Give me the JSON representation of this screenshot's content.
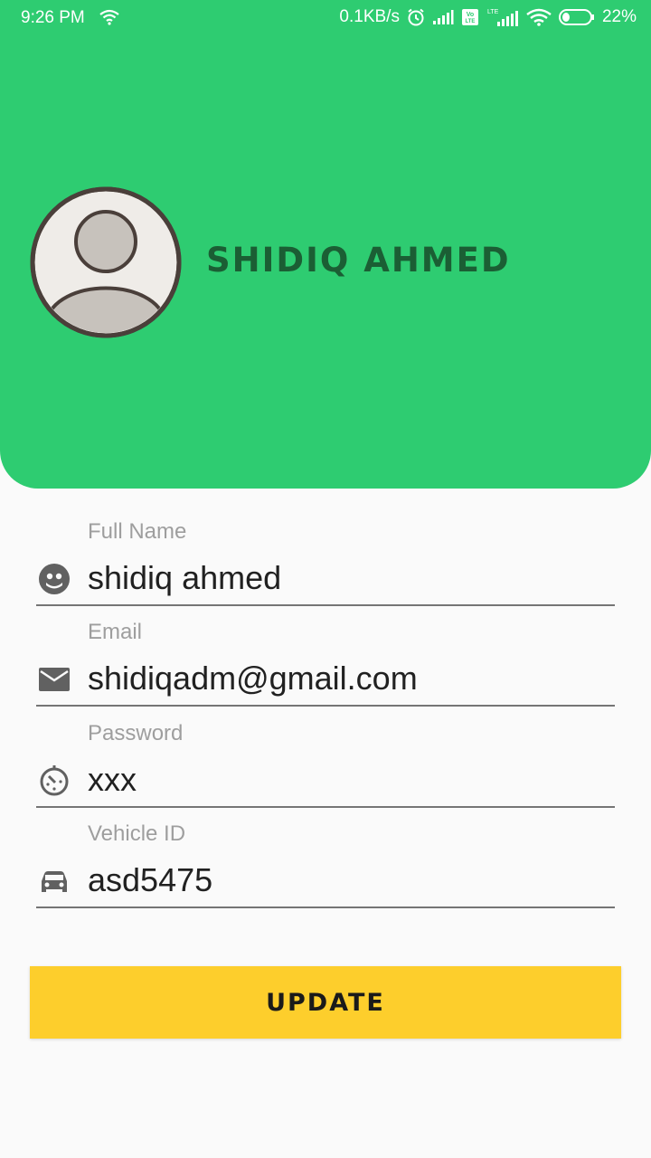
{
  "status_bar": {
    "time": "9:26 PM",
    "network_speed": "0.1KB/s",
    "battery": "22%"
  },
  "profile": {
    "name": "SHIDIQ AHMED"
  },
  "fields": [
    {
      "label": "Full Name",
      "value": "shidiq ahmed",
      "icon": "face-icon"
    },
    {
      "label": "Email",
      "value": "shidiqadm@gmail.com",
      "icon": "mail-icon"
    },
    {
      "label": "Password",
      "value": "xxx",
      "icon": "timer-icon"
    },
    {
      "label": "Vehicle ID",
      "value": "asd5475",
      "icon": "car-icon"
    }
  ],
  "actions": {
    "update_label": "UPDATE"
  },
  "colors": {
    "header_bg": "#2ecc71",
    "name_text": "#1b5e34",
    "button_bg": "#fdce2c"
  }
}
